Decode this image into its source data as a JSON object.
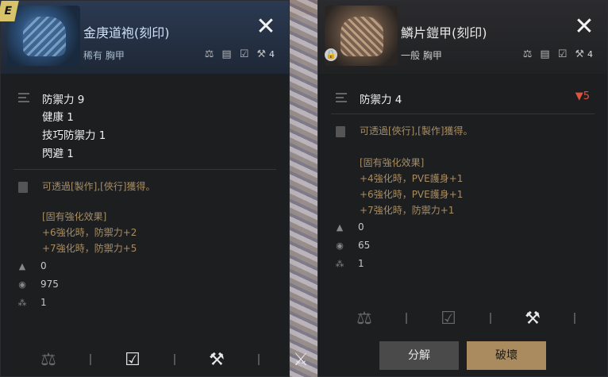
{
  "left": {
    "grade": "E",
    "item_name": "金庚道袍(刻印)",
    "item_sub": "稀有 胸甲",
    "equip_count": "4",
    "stats": [
      "防禦力 9",
      "健康 1",
      "技巧防禦力 1",
      "閃避 1"
    ],
    "desc_line": "可透過[製作],[俠行]獲得。",
    "enhance_title": "[固有強化效果]",
    "enhance_lines": [
      "+6強化時，防禦力+2",
      "+7強化時，防禦力+5"
    ],
    "meta": [
      "0",
      "975",
      "1"
    ]
  },
  "right": {
    "item_name": "鱗片鎧甲(刻印)",
    "item_sub": "一般 胸甲",
    "equip_count": "4",
    "stat": "防禦力 4",
    "diff": "▼5",
    "desc_line": "可透過[俠行],[製作]獲得。",
    "enhance_title": "[固有強化效果]",
    "enhance_lines": [
      "+4強化時，PVE護身+1",
      "+6強化時，PVE護身+1",
      "+7強化時，防禦力+1"
    ],
    "meta": [
      "0",
      "65",
      "1"
    ],
    "btn_dismantle": "分解",
    "btn_destroy": "破壞"
  },
  "colors": {
    "accent_gold": "#a98b5f",
    "desc": "#a88d63",
    "down_red": "#e0523e"
  },
  "icons": [
    "close-icon",
    "scale-icon",
    "card-icon",
    "check-icon",
    "anvil-icon",
    "hammer-icon",
    "lock-icon"
  ]
}
